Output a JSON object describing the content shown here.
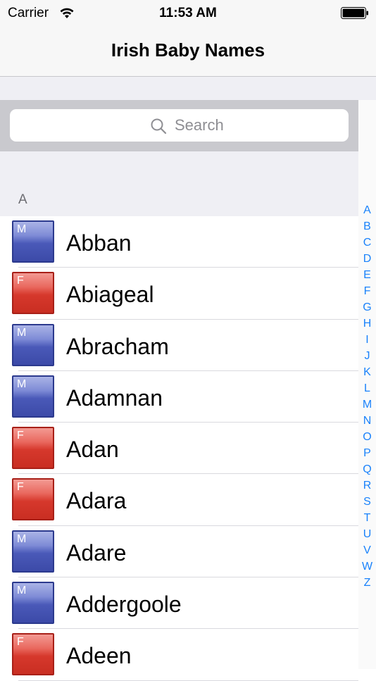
{
  "status_bar": {
    "carrier": "Carrier",
    "time": "11:53 AM"
  },
  "navbar": {
    "title": "Irish Baby Names"
  },
  "search": {
    "placeholder": "Search"
  },
  "section": {
    "letter": "A"
  },
  "names": [
    {
      "gender": "M",
      "name": "Abban"
    },
    {
      "gender": "F",
      "name": "Abiageal"
    },
    {
      "gender": "M",
      "name": "Abracham"
    },
    {
      "gender": "M",
      "name": "Adamnan"
    },
    {
      "gender": "F",
      "name": "Adan"
    },
    {
      "gender": "F",
      "name": "Adara"
    },
    {
      "gender": "M",
      "name": "Adare"
    },
    {
      "gender": "M",
      "name": "Addergoole"
    },
    {
      "gender": "F",
      "name": "Adeen"
    }
  ],
  "index_letters": [
    "A",
    "B",
    "C",
    "D",
    "E",
    "F",
    "G",
    "H",
    "I",
    "J",
    "K",
    "L",
    "M",
    "N",
    "O",
    "P",
    "Q",
    "R",
    "S",
    "T",
    "U",
    "V",
    "W",
    "Z"
  ],
  "colors": {
    "male": "#4a59b8",
    "female": "#d6382c",
    "index": "#1a82fb"
  }
}
